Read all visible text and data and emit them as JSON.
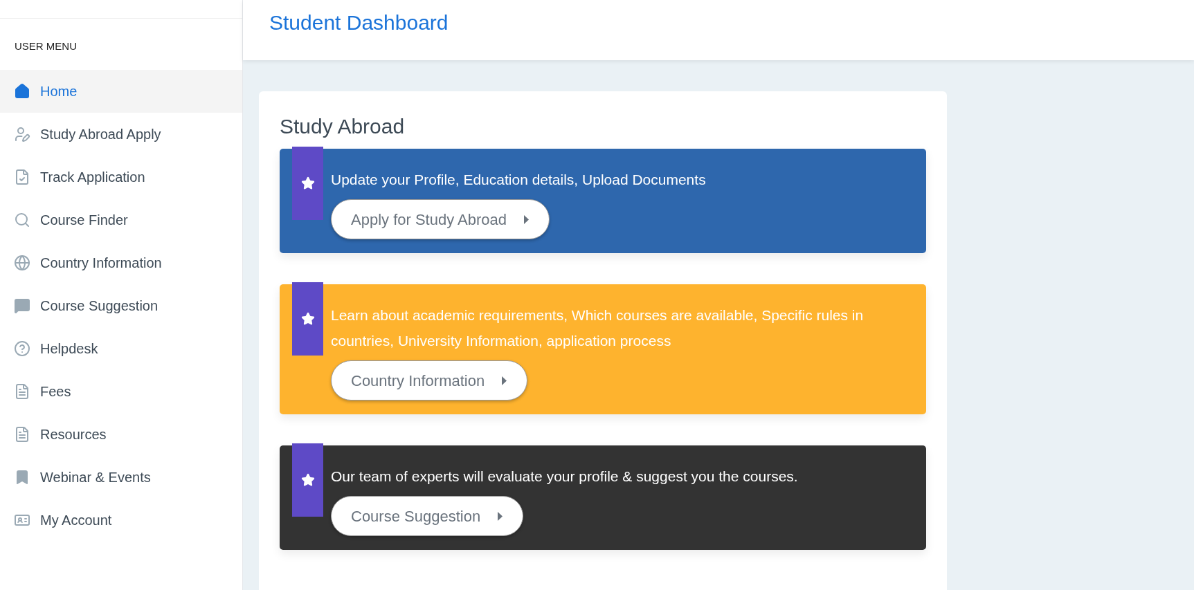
{
  "sidebar": {
    "heading": "USER MENU",
    "items": [
      {
        "label": "Home",
        "selected": true
      },
      {
        "label": "Study Abroad Apply",
        "selected": false
      },
      {
        "label": "Track Application",
        "selected": false
      },
      {
        "label": "Course Finder",
        "selected": false
      },
      {
        "label": "Country Information",
        "selected": false
      },
      {
        "label": "Course Suggestion",
        "selected": false
      },
      {
        "label": "Helpdesk",
        "selected": false
      },
      {
        "label": "Fees",
        "selected": false
      },
      {
        "label": "Resources",
        "selected": false
      },
      {
        "label": "Webinar & Events",
        "selected": false
      },
      {
        "label": "My Account",
        "selected": false
      }
    ]
  },
  "header": {
    "title": "Student Dashboard"
  },
  "card": {
    "title": "Study Abroad",
    "banners": [
      {
        "color": "#2e67ad",
        "text": "Update your Profile, Education details, Upload Documents",
        "button": "Apply for Study Abroad"
      },
      {
        "color": "#feb32e",
        "text": "Learn about academic requirements, Which courses are available, Specific rules in countries, University Information, application process",
        "button": "Country Information"
      },
      {
        "color": "#333333",
        "text": "Our team of experts will evaluate your profile & suggest you the courses.",
        "button": "Course Suggestion"
      }
    ]
  }
}
